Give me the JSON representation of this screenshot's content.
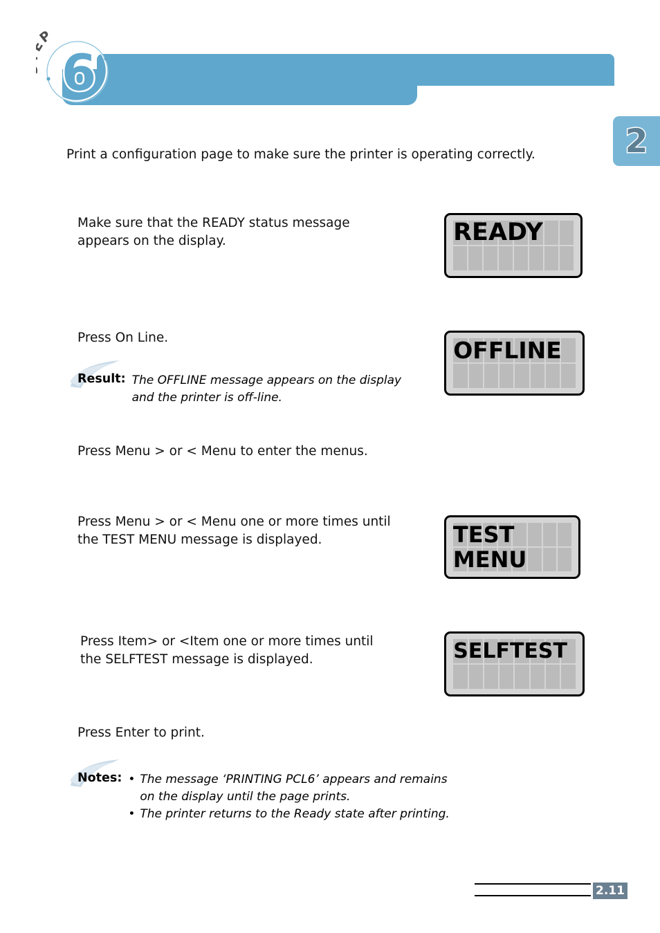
{
  "header": {
    "step_word": "STEP",
    "step_number": "6",
    "chapter_number": "2"
  },
  "intro": {
    "text": "Print a configuration page to make sure the printer is operating correctly."
  },
  "steps": [
    {
      "id": "ready",
      "instruction": "Make sure that the READY status message\nappears on the display.",
      "display": {
        "name": "ready-lcd",
        "lines": [
          "READY",
          ""
        ],
        "columns": 8,
        "rows": 2
      }
    },
    {
      "id": "online",
      "instruction": "Press On Line.",
      "callout": {
        "label": "Result:",
        "body": "The OFFLINE message appears on the display\nand the printer is off-line."
      },
      "display": {
        "name": "offline-lcd",
        "lines": [
          "OFFLINE",
          ""
        ],
        "columns": 8,
        "rows": 2
      }
    },
    {
      "id": "enter-menus",
      "instruction": "Press Menu > or < Menu to enter the menus."
    },
    {
      "id": "test-menu",
      "instruction": "Press Menu > or < Menu one or more times until\nthe TEST MENU message is displayed.",
      "display": {
        "name": "test-menu-lcd",
        "lines": [
          "TEST",
          "MENU"
        ],
        "columns": 8,
        "rows": 2
      }
    },
    {
      "id": "selftest",
      "instruction": "Press Item> or <Item one or more times until\nthe SELFTEST message is displayed.",
      "display": {
        "name": "selftest-lcd",
        "lines": [
          "SELFTEST",
          ""
        ],
        "columns": 8,
        "rows": 2
      }
    },
    {
      "id": "print",
      "instruction": "Press Enter to print.",
      "notes": {
        "label": "Notes:",
        "items": [
          "The message ‘PRINTING PCL6’ appears and remains\non the display until the page prints.",
          "The printer returns to the Ready state after printing."
        ]
      }
    }
  ],
  "footer": {
    "page_number": "2.11"
  },
  "colors": {
    "banner_blue": "#5fa7cc",
    "chapter_tab_blue": "#79b6d6",
    "chapter_numeral": "#5d7f93",
    "page_box": "#6b8091",
    "lcd_background": "#d5d5d5",
    "lcd_cell": "#bbbbbb",
    "brush": "#c8d9e6"
  }
}
